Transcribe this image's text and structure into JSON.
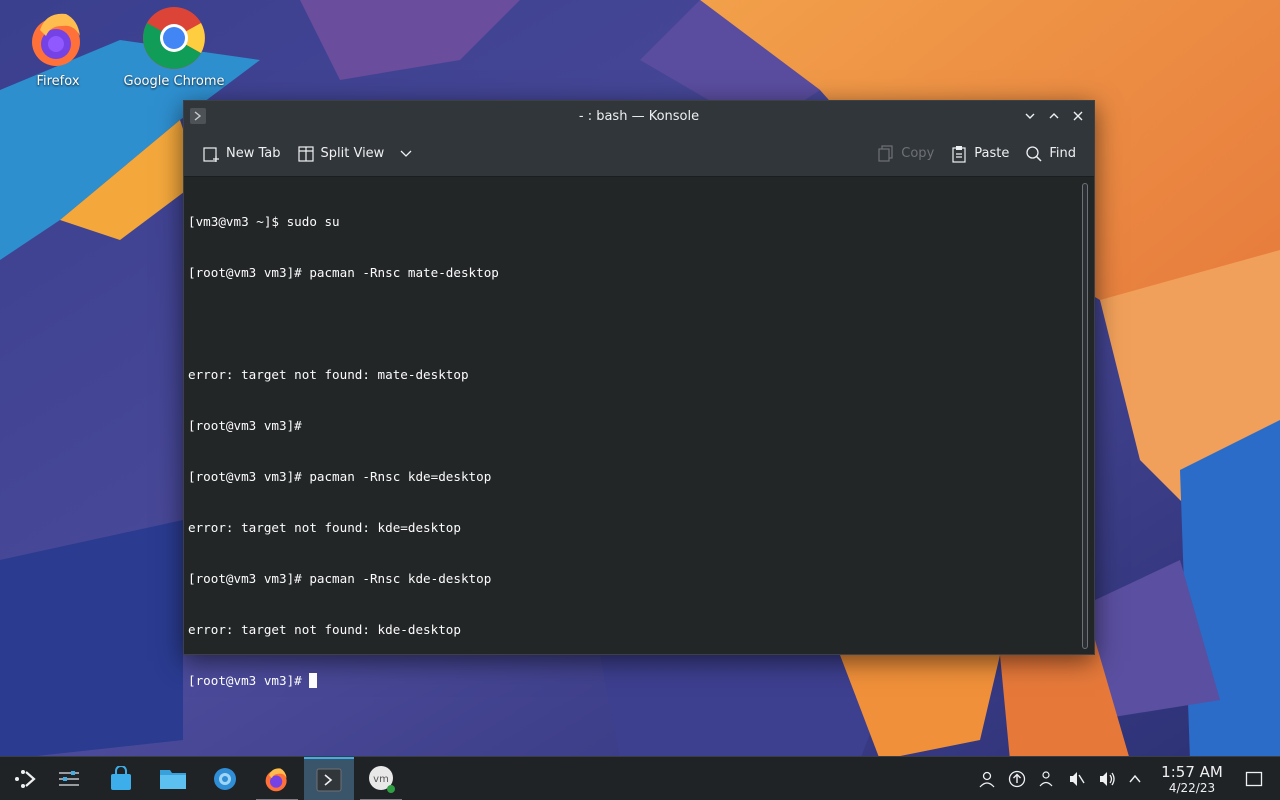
{
  "desktop": {
    "icons": [
      {
        "label": "Firefox",
        "icon": "firefox-icon"
      },
      {
        "label": "Google Chrome",
        "icon": "chrome-icon"
      }
    ]
  },
  "window": {
    "title": "- : bash — Konsole",
    "toolbar": {
      "new_tab": "New Tab",
      "split_view": "Split View",
      "copy": "Copy",
      "paste": "Paste",
      "find": "Find"
    },
    "terminal_lines": [
      "[vm3@vm3 ~]$ sudo su",
      "[root@vm3 vm3]# pacman -Rnsc mate-desktop",
      "",
      "error: target not found: mate-desktop",
      "[root@vm3 vm3]#",
      "[root@vm3 vm3]# pacman -Rnsc kde=desktop",
      "error: target not found: kde=desktop",
      "[root@vm3 vm3]# pacman -Rnsc kde-desktop",
      "error: target not found: kde-desktop"
    ],
    "prompt": "[root@vm3 vm3]# "
  },
  "taskbar": {
    "apps": [
      "app-launcher-icon",
      "pager-icon",
      "discover-icon",
      "dolphin-icon",
      "settings-icon",
      "firefox-icon",
      "konsole-icon",
      "vmware-icon"
    ],
    "tray": [
      "user-icon",
      "update-icon",
      "network-icon",
      "mute-icon",
      "volume-icon",
      "chevron-up-icon"
    ],
    "time": "1:57 AM",
    "date": "4/22/23"
  },
  "colors": {
    "terminal_bg": "#232627",
    "titlebar_bg": "#31363b",
    "accent": "#3daee9"
  }
}
